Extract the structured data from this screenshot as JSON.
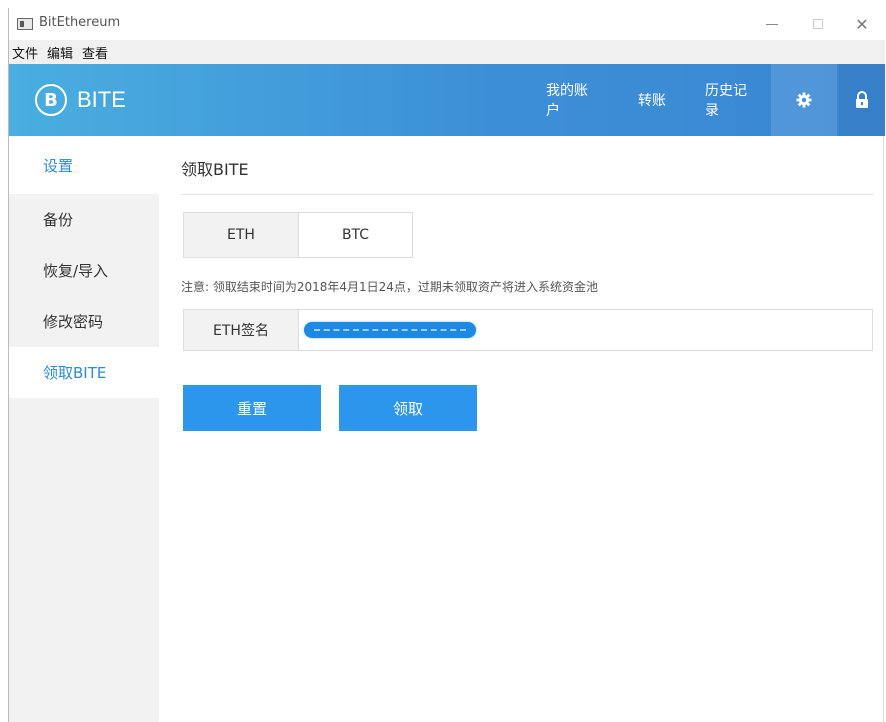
{
  "window": {
    "title": "BitEthereum"
  },
  "menubar": {
    "items": [
      "文件",
      "编辑",
      "查看"
    ]
  },
  "header": {
    "logo_text": "BITE",
    "logo_mark": "B",
    "nav": {
      "account": "我的账户",
      "transfer": "转账",
      "history": "历史记录"
    },
    "icons": {
      "settings": "gear-icon",
      "lock": "lock-icon"
    }
  },
  "sidebar": {
    "items": [
      {
        "label": "设置"
      },
      {
        "label": "备份"
      },
      {
        "label": "恢复/导入"
      },
      {
        "label": "修改密码"
      },
      {
        "label": "领取BITE"
      }
    ]
  },
  "main": {
    "title": "领取BITE",
    "tabs": [
      {
        "label": "ETH"
      },
      {
        "label": "BTC"
      }
    ],
    "notice": "注意: 领取结束时间为2018年4月1日24点，过期未领取资产将进入系统资金池",
    "signature": {
      "label": "ETH签名",
      "value": ""
    },
    "buttons": {
      "reset": "重置",
      "claim": "领取"
    }
  },
  "colors": {
    "accent": "#2b96ec",
    "header_start": "#4aaee0",
    "header_end": "#3a86d4",
    "active_text": "#2f8ad1"
  }
}
